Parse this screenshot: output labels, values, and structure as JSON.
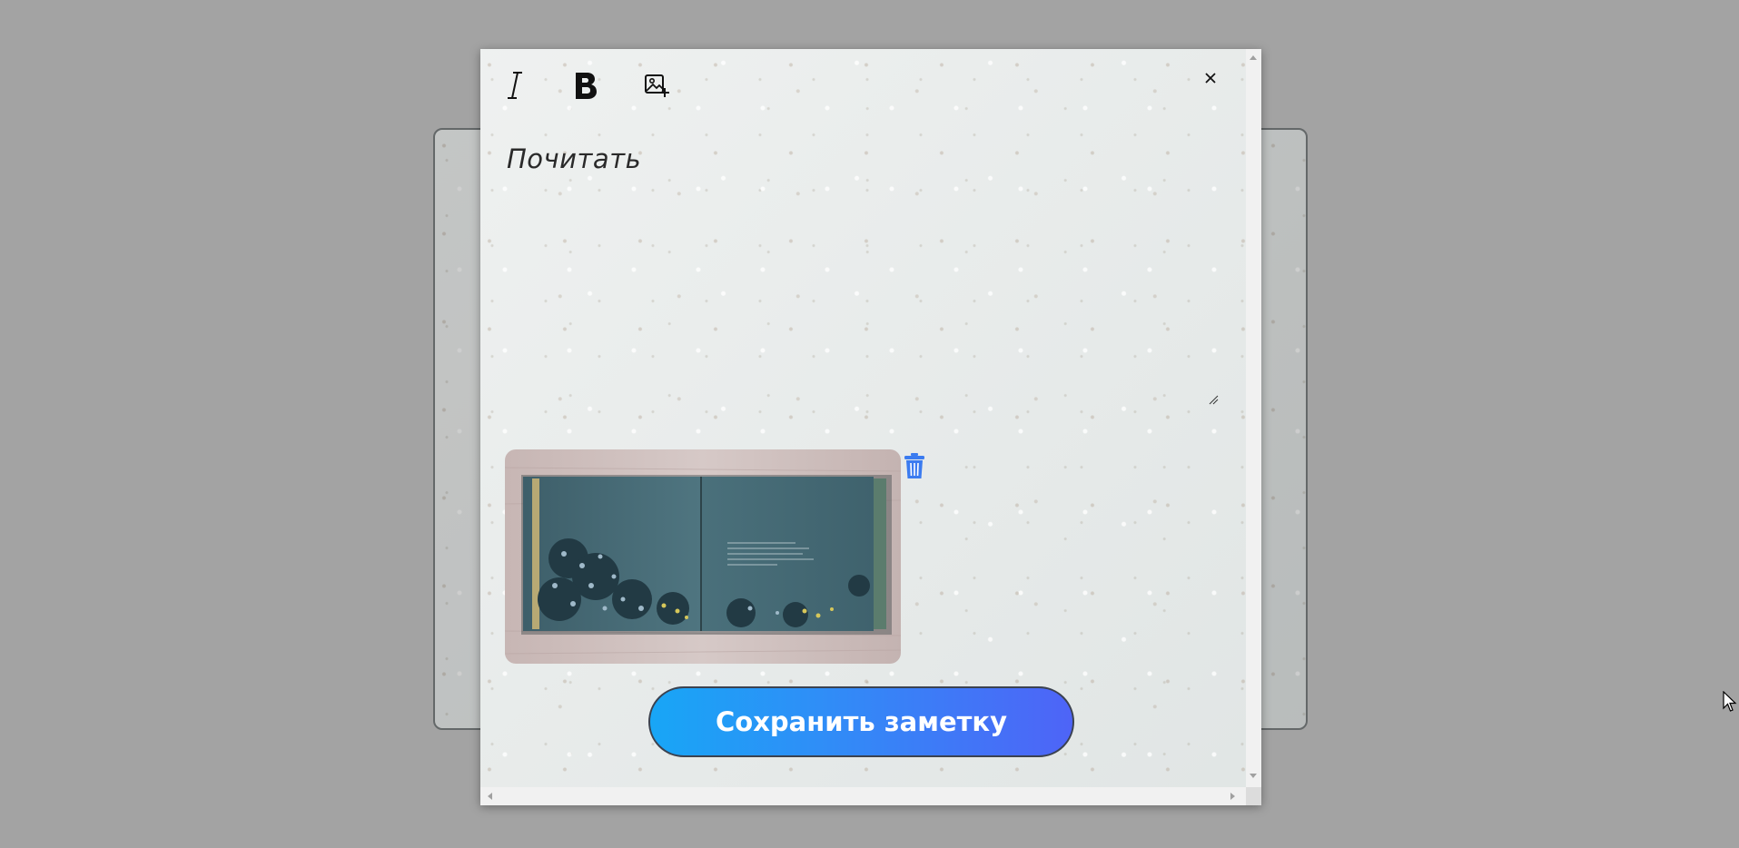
{
  "editor": {
    "toolbar": {
      "italic_icon": "italic-icon",
      "bold_icon": "bold-icon",
      "add_image_icon": "add-image-icon"
    },
    "close_label": "×",
    "note_text": "Почитать",
    "attached_image": {
      "description_icon": "book-photo",
      "delete_icon": "trash-icon"
    },
    "save_label": "Сохранить заметку"
  },
  "colors": {
    "page_background": "#a3a3a3",
    "save_gradient_start": "#18a6f6",
    "save_gradient_end": "#4e64f7",
    "trash_icon": "#3b7bf0"
  }
}
